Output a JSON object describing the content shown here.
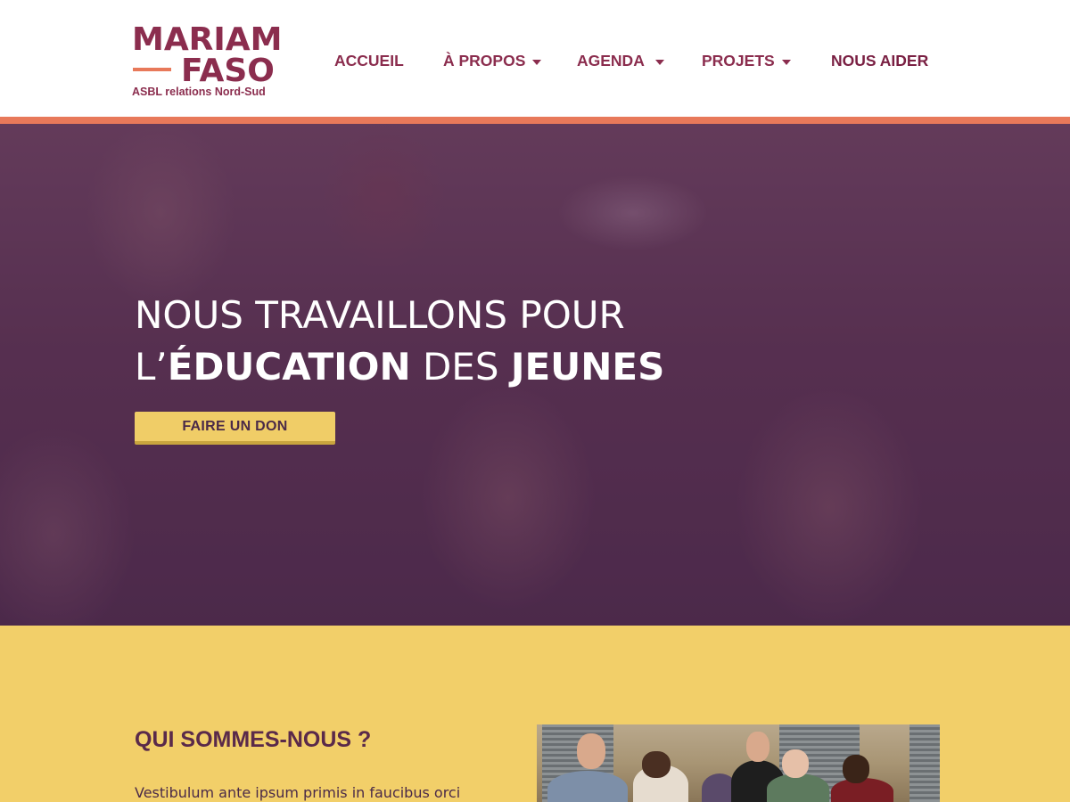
{
  "logo": {
    "line1": "MARIAM",
    "line2": "FASO",
    "tagline": "ASBL relations Nord-Sud"
  },
  "nav": {
    "items": [
      {
        "label": "ACCUEIL",
        "dropdown": false
      },
      {
        "label": "À PROPOS",
        "dropdown": true
      },
      {
        "label": "AGENDA",
        "dropdown": true
      },
      {
        "label": "PROJETS",
        "dropdown": true
      },
      {
        "label": "NOUS AIDER",
        "dropdown": false
      }
    ]
  },
  "hero": {
    "line1": "NOUS TRAVAILLONS POUR",
    "line2_prefix": "L’",
    "line2_bold1": "ÉDUCATION",
    "line2_mid": " DES ",
    "line2_bold2": "JEUNES",
    "button_label": "FAIRE UN DON"
  },
  "about": {
    "title": "QUI SOMMES-NOUS ?",
    "text": "Vestibulum ante ipsum primis in faucibus orci"
  },
  "colors": {
    "brand": "#8b2d4e",
    "accent_orange": "#e8795a",
    "accent_yellow": "#f2cf69",
    "hero_tint": "#5a3450"
  }
}
